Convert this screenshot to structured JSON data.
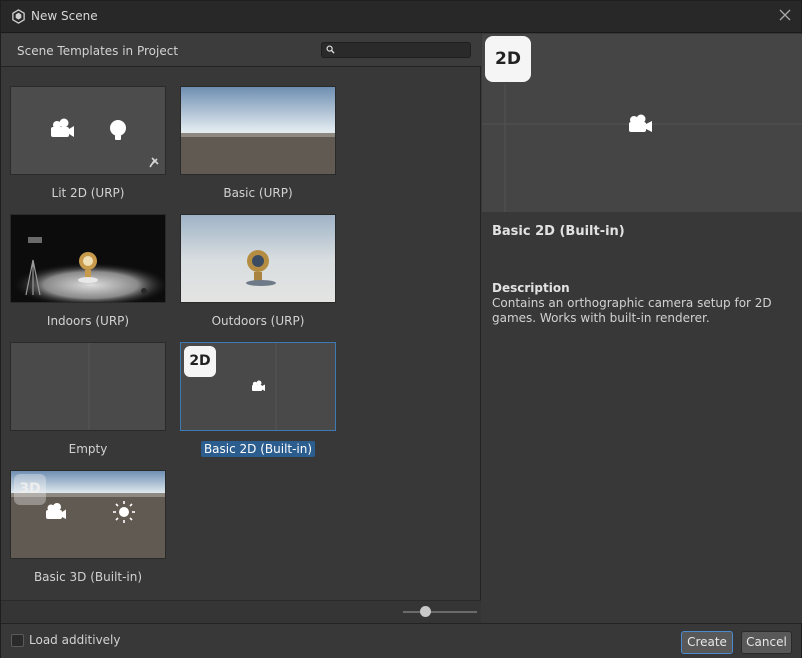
{
  "window": {
    "title": "New Scene"
  },
  "left": {
    "header": "Scene Templates in Project",
    "search": {
      "value": "",
      "placeholder": ""
    }
  },
  "templates": [
    {
      "name": "Lit 2D (URP)",
      "pinned": true
    },
    {
      "name": "Basic (URP)"
    },
    {
      "name": "Indoors (URP)"
    },
    {
      "name": "Outdoors (URP)"
    },
    {
      "name": "Empty"
    },
    {
      "name": "Basic 2D (Built-in)",
      "selected": true,
      "badge": "2D"
    },
    {
      "name": "Basic 3D (Built-in)",
      "badge": "3D"
    }
  ],
  "zoom_slider": {
    "value": 0.3
  },
  "details": {
    "preview_badge": "2D",
    "title": "Basic 2D (Built-in)",
    "description_heading": "Description",
    "description": "Contains an orthographic camera setup for 2D games. Works with built-in renderer."
  },
  "footer": {
    "load_additively_label": "Load additively",
    "load_additively_checked": false,
    "create_label": "Create",
    "cancel_label": "Cancel"
  },
  "colors": {
    "accent": "#2c5d8f",
    "panel": "#383838",
    "titlebar": "#282828"
  }
}
